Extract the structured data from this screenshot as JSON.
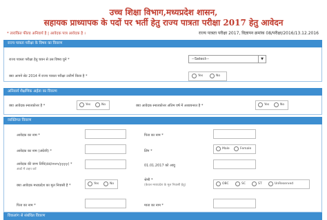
{
  "header": {
    "line1": "उच्च शिक्षा विभाग,मध्यप्रदेश शासन,",
    "line2": "सहायक प्राध्यापक के पदों पर भर्ती हेतु राज्य पात्रता परीक्षा 2017 हेतु आवेदन",
    "note_left": "* तारांकित फील्ड अनिवार्य है | आवेदक पात्र आवेदक है ।",
    "note_right": "राज्य पात्रता परीक्षा 2017, विज्ञापन क्रमांक 08/परीक्षा/2016/13.12.2016"
  },
  "sections": {
    "exam": {
      "title": "राज्य पात्रता परीक्षा के विषय का विवरण",
      "subject_label": "राज्य पात्रता परीक्षा हेतु चयन से उस विषय चुने *",
      "subject_value": "--Select--",
      "prev_label": "क्या आपने सेट 2014 में राज्य पात्रता परीक्षा उत्तीर्ण किया है *",
      "yes": "Yes",
      "no": "No"
    },
    "qualification": {
      "title": "अनिवार्य शैक्षणिक अर्हता का विवरण",
      "pg_label": "क्या आवेदक स्नातकोत्तर है *",
      "final_label": "क्या आवेदक स्नातकोत्तर अंतिम वर्ष में अध्ययनरत है *",
      "yes": "Yes",
      "no": "No"
    },
    "personal": {
      "title": "व्यक्तिगत विवरण",
      "name_label": "आवेदक का नाम *",
      "father_label": "पिता का नाम *",
      "name_en_label": "आवेदक का नाम (अंग्रेजी) *",
      "gender_label": "लिंग *",
      "male": "Male",
      "female": "Female",
      "dob_label": "आवेदक की जन्म तिथि(dd/mm/yyyy) *",
      "dob_hint": "अंकों में टाइप करें",
      "age_label": "01.01.2017 को आयु",
      "mp_label": "क्या आवेदक मध्यप्रदेश का मूल निवासी है *",
      "cat_label": "श्रेणी *",
      "cat_hint": "(केवल मध्यप्रदेश के मूल निवासी हेतु)",
      "yes": "Yes",
      "no": "No",
      "obc": "OBC",
      "sc": "SC",
      "st": "ST",
      "unreserved": "UnReserved",
      "mother_label": "पिता का नाम *",
      "mother_label2": "माता का नाम *"
    },
    "next": {
      "title": "विकलांग से संबंधित विवरण"
    }
  }
}
